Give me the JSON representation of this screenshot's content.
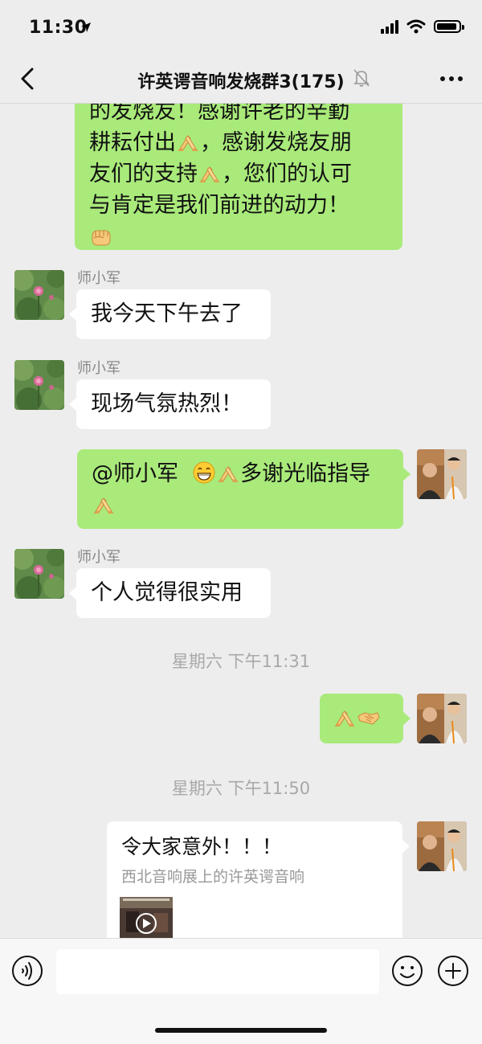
{
  "status_bar": {
    "time": "11:30"
  },
  "nav": {
    "title": "许英谔音响发烧群3(175)"
  },
  "messages": {
    "m0": {
      "lines": [
        "的发烧友！感谢许老的辛勤",
        "耕耘付出",
        "，感谢发烧友朋",
        "友们的支持",
        "，您们的认可",
        "与肯定是我们前进的动力！"
      ]
    },
    "m1": {
      "sender": "师小军",
      "text": "我今天下午去了"
    },
    "m2": {
      "sender": "师小军",
      "text": "现场气氛热烈！"
    },
    "m3": {
      "mention": "@师小军",
      "text": "多谢光临指导"
    },
    "m4": {
      "sender": "师小军",
      "text": "个人觉得很实用"
    },
    "ts1": "星期六 下午11:31",
    "ts2": "星期六 下午11:50",
    "m6": {
      "title": "令大家意外！！！",
      "desc": "西北音响展上的许英谔音响"
    }
  },
  "icons": {
    "back": "chevron-left-icon",
    "mute": "bell-off-icon",
    "more": "more-dots-icon",
    "voice": "voice-icon",
    "emoji": "emoji-smile-icon",
    "plus": "plus-circle-icon",
    "play": "play-icon"
  },
  "colors": {
    "my_bubble": "#a9ea7a",
    "other_bubble": "#ffffff",
    "background": "#ededed"
  }
}
